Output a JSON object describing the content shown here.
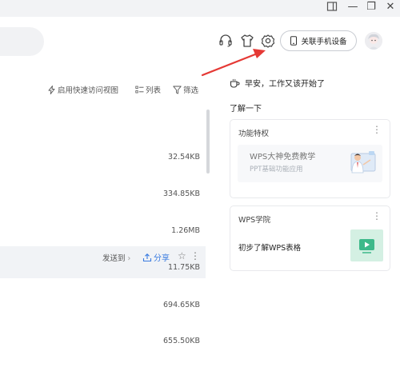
{
  "titlebar": {
    "icons": [
      "panel-icon",
      "minimize-icon",
      "restore-icon",
      "close-icon"
    ],
    "minimize_glyph": "—",
    "restore_glyph": "❐",
    "close_glyph": "✕"
  },
  "header": {
    "icons": [
      "headset-icon",
      "skin-icon",
      "gear-icon"
    ],
    "connect_phone_label": "关联手机设备",
    "avatar": "avatar-image"
  },
  "annotation": {
    "arrow_color": "#e53935"
  },
  "viewbar": {
    "quick_view_label": "启用快速访问视图",
    "list_label": "列表",
    "filter_label": "筛选"
  },
  "files": {
    "sizes": [
      "32.54KB",
      "334.85KB",
      "1.26MB",
      "11.75KB",
      "694.65KB",
      "655.50KB"
    ],
    "hovered_row": {
      "send_to_label": "发送到",
      "send_to_chevron": "›",
      "share_label": "分享",
      "star_glyph": "☆",
      "more_glyph": "⋮"
    }
  },
  "side_panel": {
    "greeting": "早安，工作又该开始了",
    "learn_more": "了解一下",
    "cards": [
      {
        "title": "功能特权",
        "more": "⋮",
        "banner_title": "WPS大神免费教学",
        "banner_subtitle": "PPT基础功能应用"
      },
      {
        "title": "WPS学院",
        "more": "⋮",
        "item_label": "初步了解WPS表格"
      }
    ]
  },
  "colors": {
    "accent_blue": "#3a7be0",
    "arrow_red": "#e53935",
    "video_green": "#3db98a"
  }
}
